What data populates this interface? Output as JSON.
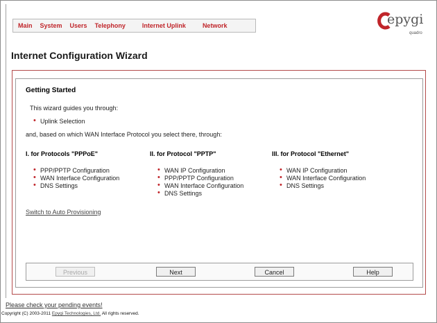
{
  "nav": {
    "items": [
      "Main",
      "System",
      "Users",
      "Telephony",
      "Internet Uplink",
      "Network"
    ]
  },
  "logo": {
    "brand": "epygi",
    "sub": "quadro"
  },
  "page_title": "Internet Configuration Wizard",
  "wizard": {
    "section_title": "Getting Started",
    "intro": "This wizard guides you through:",
    "first_step": "Uplink Selection",
    "transition": "and, based on which WAN Interface Protocol you select there, through:",
    "columns": [
      {
        "heading": "I. for Protocols \"PPPoE\"",
        "items": [
          "PPP/PPTP Configuration",
          "WAN Interface Configuration",
          "DNS Settings"
        ]
      },
      {
        "heading": "II. for Protocol \"PPTP\"",
        "items": [
          "WAN IP Configuration",
          "PPP/PPTP Configuration",
          "WAN Interface Configuration",
          "DNS Settings"
        ]
      },
      {
        "heading": "III. for Protocol \"Ethernet\"",
        "items": [
          "WAN IP Configuration",
          "WAN Interface Configuration",
          "DNS Settings"
        ]
      }
    ],
    "auto_provisioning_link": "Switch to Auto Provisioning"
  },
  "buttons": {
    "previous": "Previous",
    "next": "Next",
    "cancel": "Cancel",
    "help": "Help"
  },
  "footer": {
    "events_link": "Please check your pending events!",
    "copyright_prefix": "Copyright (C) 2003-2011",
    "copyright_company": "Epygi Technologies, Ltd.",
    "copyright_suffix": "All rights reserved."
  }
}
